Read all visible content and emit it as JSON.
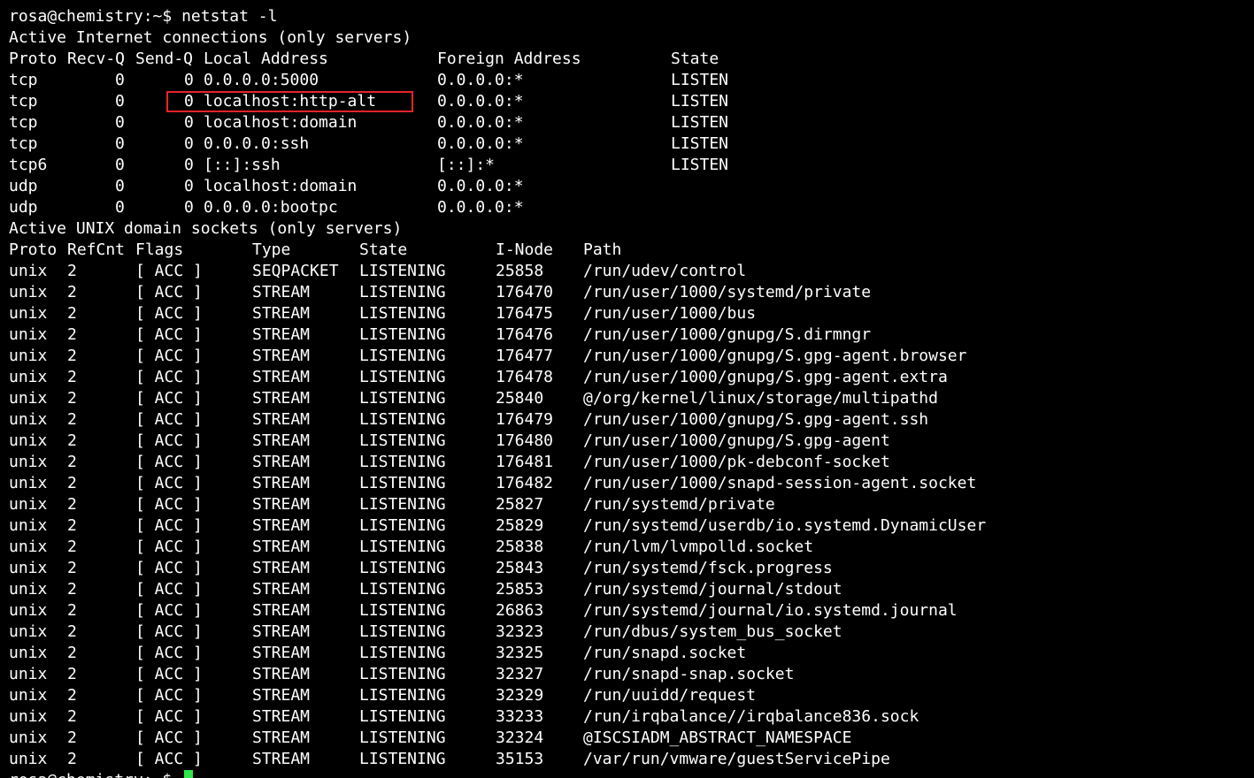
{
  "terminal": {
    "colors": {
      "background": "#000000",
      "foreground": "#ffffff",
      "highlight_box": "#e8232b",
      "cursor": "#2ee64a"
    },
    "prompt_line": "rosa@chemistry:~$ netstat -l",
    "inet_heading": "Active Internet connections (only servers)",
    "inet_columns": {
      "proto": "Proto",
      "recvq": "Recv-Q",
      "sendq": "Send-Q",
      "local": "Local Address",
      "foreign": "Foreign Address",
      "state": "State"
    },
    "inet_rows": [
      {
        "proto": "tcp",
        "recvq": "0",
        "sendq": "0",
        "local": "0.0.0.0:5000",
        "foreign": "0.0.0.0:*",
        "state": "LISTEN"
      },
      {
        "proto": "tcp",
        "recvq": "0",
        "sendq": "0",
        "local": "localhost:http-alt",
        "foreign": "0.0.0.0:*",
        "state": "LISTEN"
      },
      {
        "proto": "tcp",
        "recvq": "0",
        "sendq": "0",
        "local": "localhost:domain",
        "foreign": "0.0.0.0:*",
        "state": "LISTEN"
      },
      {
        "proto": "tcp",
        "recvq": "0",
        "sendq": "0",
        "local": "0.0.0.0:ssh",
        "foreign": "0.0.0.0:*",
        "state": "LISTEN"
      },
      {
        "proto": "tcp6",
        "recvq": "0",
        "sendq": "0",
        "local": "[::]:ssh",
        "foreign": "[::]:*",
        "state": "LISTEN"
      },
      {
        "proto": "udp",
        "recvq": "0",
        "sendq": "0",
        "local": "localhost:domain",
        "foreign": "0.0.0.0:*",
        "state": ""
      },
      {
        "proto": "udp",
        "recvq": "0",
        "sendq": "0",
        "local": "0.0.0.0:bootpc",
        "foreign": "0.0.0.0:*",
        "state": ""
      }
    ],
    "unix_heading": "Active UNIX domain sockets (only servers)",
    "unix_columns": {
      "proto": "Proto",
      "refcnt": "RefCnt",
      "flags": "Flags",
      "type": "Type",
      "state": "State",
      "inode": "I-Node",
      "path": "Path"
    },
    "unix_rows": [
      {
        "proto": "unix",
        "refcnt": "2",
        "flags": "[ ACC ]",
        "type": "SEQPACKET",
        "state": "LISTENING",
        "inode": "25858",
        "path": "/run/udev/control"
      },
      {
        "proto": "unix",
        "refcnt": "2",
        "flags": "[ ACC ]",
        "type": "STREAM",
        "state": "LISTENING",
        "inode": "176470",
        "path": "/run/user/1000/systemd/private"
      },
      {
        "proto": "unix",
        "refcnt": "2",
        "flags": "[ ACC ]",
        "type": "STREAM",
        "state": "LISTENING",
        "inode": "176475",
        "path": "/run/user/1000/bus"
      },
      {
        "proto": "unix",
        "refcnt": "2",
        "flags": "[ ACC ]",
        "type": "STREAM",
        "state": "LISTENING",
        "inode": "176476",
        "path": "/run/user/1000/gnupg/S.dirmngr"
      },
      {
        "proto": "unix",
        "refcnt": "2",
        "flags": "[ ACC ]",
        "type": "STREAM",
        "state": "LISTENING",
        "inode": "176477",
        "path": "/run/user/1000/gnupg/S.gpg-agent.browser"
      },
      {
        "proto": "unix",
        "refcnt": "2",
        "flags": "[ ACC ]",
        "type": "STREAM",
        "state": "LISTENING",
        "inode": "176478",
        "path": "/run/user/1000/gnupg/S.gpg-agent.extra"
      },
      {
        "proto": "unix",
        "refcnt": "2",
        "flags": "[ ACC ]",
        "type": "STREAM",
        "state": "LISTENING",
        "inode": "25840",
        "path": "@/org/kernel/linux/storage/multipathd"
      },
      {
        "proto": "unix",
        "refcnt": "2",
        "flags": "[ ACC ]",
        "type": "STREAM",
        "state": "LISTENING",
        "inode": "176479",
        "path": "/run/user/1000/gnupg/S.gpg-agent.ssh"
      },
      {
        "proto": "unix",
        "refcnt": "2",
        "flags": "[ ACC ]",
        "type": "STREAM",
        "state": "LISTENING",
        "inode": "176480",
        "path": "/run/user/1000/gnupg/S.gpg-agent"
      },
      {
        "proto": "unix",
        "refcnt": "2",
        "flags": "[ ACC ]",
        "type": "STREAM",
        "state": "LISTENING",
        "inode": "176481",
        "path": "/run/user/1000/pk-debconf-socket"
      },
      {
        "proto": "unix",
        "refcnt": "2",
        "flags": "[ ACC ]",
        "type": "STREAM",
        "state": "LISTENING",
        "inode": "176482",
        "path": "/run/user/1000/snapd-session-agent.socket"
      },
      {
        "proto": "unix",
        "refcnt": "2",
        "flags": "[ ACC ]",
        "type": "STREAM",
        "state": "LISTENING",
        "inode": "25827",
        "path": "/run/systemd/private"
      },
      {
        "proto": "unix",
        "refcnt": "2",
        "flags": "[ ACC ]",
        "type": "STREAM",
        "state": "LISTENING",
        "inode": "25829",
        "path": "/run/systemd/userdb/io.systemd.DynamicUser"
      },
      {
        "proto": "unix",
        "refcnt": "2",
        "flags": "[ ACC ]",
        "type": "STREAM",
        "state": "LISTENING",
        "inode": "25838",
        "path": "/run/lvm/lvmpolld.socket"
      },
      {
        "proto": "unix",
        "refcnt": "2",
        "flags": "[ ACC ]",
        "type": "STREAM",
        "state": "LISTENING",
        "inode": "25843",
        "path": "/run/systemd/fsck.progress"
      },
      {
        "proto": "unix",
        "refcnt": "2",
        "flags": "[ ACC ]",
        "type": "STREAM",
        "state": "LISTENING",
        "inode": "25853",
        "path": "/run/systemd/journal/stdout"
      },
      {
        "proto": "unix",
        "refcnt": "2",
        "flags": "[ ACC ]",
        "type": "STREAM",
        "state": "LISTENING",
        "inode": "26863",
        "path": "/run/systemd/journal/io.systemd.journal"
      },
      {
        "proto": "unix",
        "refcnt": "2",
        "flags": "[ ACC ]",
        "type": "STREAM",
        "state": "LISTENING",
        "inode": "32323",
        "path": "/run/dbus/system_bus_socket"
      },
      {
        "proto": "unix",
        "refcnt": "2",
        "flags": "[ ACC ]",
        "type": "STREAM",
        "state": "LISTENING",
        "inode": "32325",
        "path": "/run/snapd.socket"
      },
      {
        "proto": "unix",
        "refcnt": "2",
        "flags": "[ ACC ]",
        "type": "STREAM",
        "state": "LISTENING",
        "inode": "32327",
        "path": "/run/snapd-snap.socket"
      },
      {
        "proto": "unix",
        "refcnt": "2",
        "flags": "[ ACC ]",
        "type": "STREAM",
        "state": "LISTENING",
        "inode": "32329",
        "path": "/run/uuidd/request"
      },
      {
        "proto": "unix",
        "refcnt": "2",
        "flags": "[ ACC ]",
        "type": "STREAM",
        "state": "LISTENING",
        "inode": "33233",
        "path": "/run/irqbalance//irqbalance836.sock"
      },
      {
        "proto": "unix",
        "refcnt": "2",
        "flags": "[ ACC ]",
        "type": "STREAM",
        "state": "LISTENING",
        "inode": "32324",
        "path": "@ISCSIADM_ABSTRACT_NAMESPACE"
      },
      {
        "proto": "unix",
        "refcnt": "2",
        "flags": "[ ACC ]",
        "type": "STREAM",
        "state": "LISTENING",
        "inode": "35153",
        "path": "/var/run/vmware/guestServicePipe"
      }
    ],
    "trailing_prompt": "rosa@chemistry:~$"
  }
}
